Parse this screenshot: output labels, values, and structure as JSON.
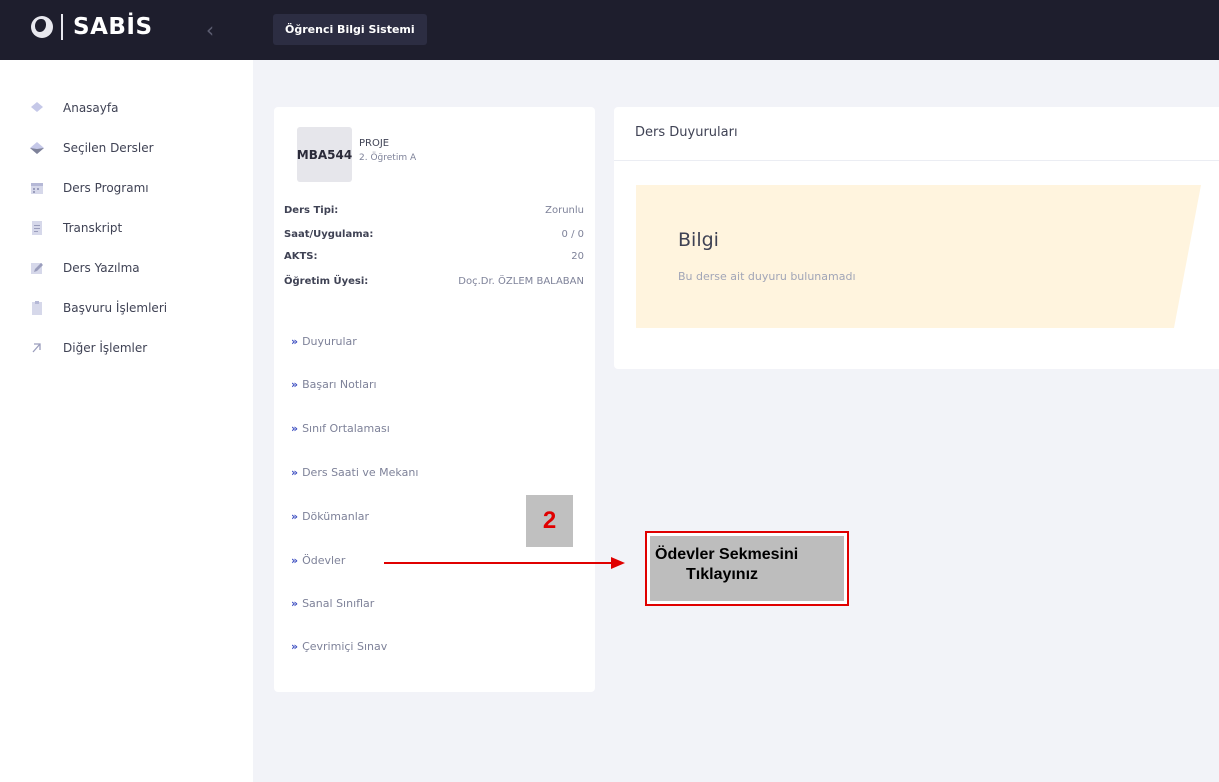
{
  "header": {
    "brand": "SABİS",
    "system_label": "Öğrenci Bilgi Sistemi"
  },
  "sidebar": {
    "items": [
      {
        "label": "Anasayfa",
        "icon": "diamond-icon"
      },
      {
        "label": "Seçilen Dersler",
        "icon": "layers-icon"
      },
      {
        "label": "Ders Programı",
        "icon": "calendar-icon"
      },
      {
        "label": "Transkript",
        "icon": "document-icon"
      },
      {
        "label": "Ders Yazılma",
        "icon": "pencil-icon"
      },
      {
        "label": "Başvuru İşlemleri",
        "icon": "clipboard-icon"
      },
      {
        "label": "Diğer İşlemler",
        "icon": "arrow-up-right-icon"
      }
    ]
  },
  "course": {
    "code": "MBA544",
    "name": "PROJE",
    "section": "2. Öğretim A",
    "info": [
      {
        "label": "Ders Tipi:",
        "value": "Zorunlu"
      },
      {
        "label": "Saat/Uygulama:",
        "value": "0 / 0"
      },
      {
        "label": "AKTS:",
        "value": "20"
      },
      {
        "label": "Öğretim Üyesi:",
        "value": "Doç.Dr. ÖZLEM BALABAN"
      }
    ],
    "menu": [
      "Duyurular",
      "Başarı Notları",
      "Sınıf Ortalaması",
      "Ders Saati ve Mekanı",
      "Dökümanlar",
      "Ödevler",
      "Sanal Sınıflar",
      "Çevrimiçi Sınav"
    ]
  },
  "announcements": {
    "title": "Ders Duyuruları",
    "info_heading": "Bilgi",
    "info_text": "Bu derse ait duyuru bulunamadı"
  },
  "annotation": {
    "step": "2",
    "callout_line1": "Ödevler Sekmesini",
    "callout_line2": "Tıklayınız",
    "color": "#e00000"
  }
}
